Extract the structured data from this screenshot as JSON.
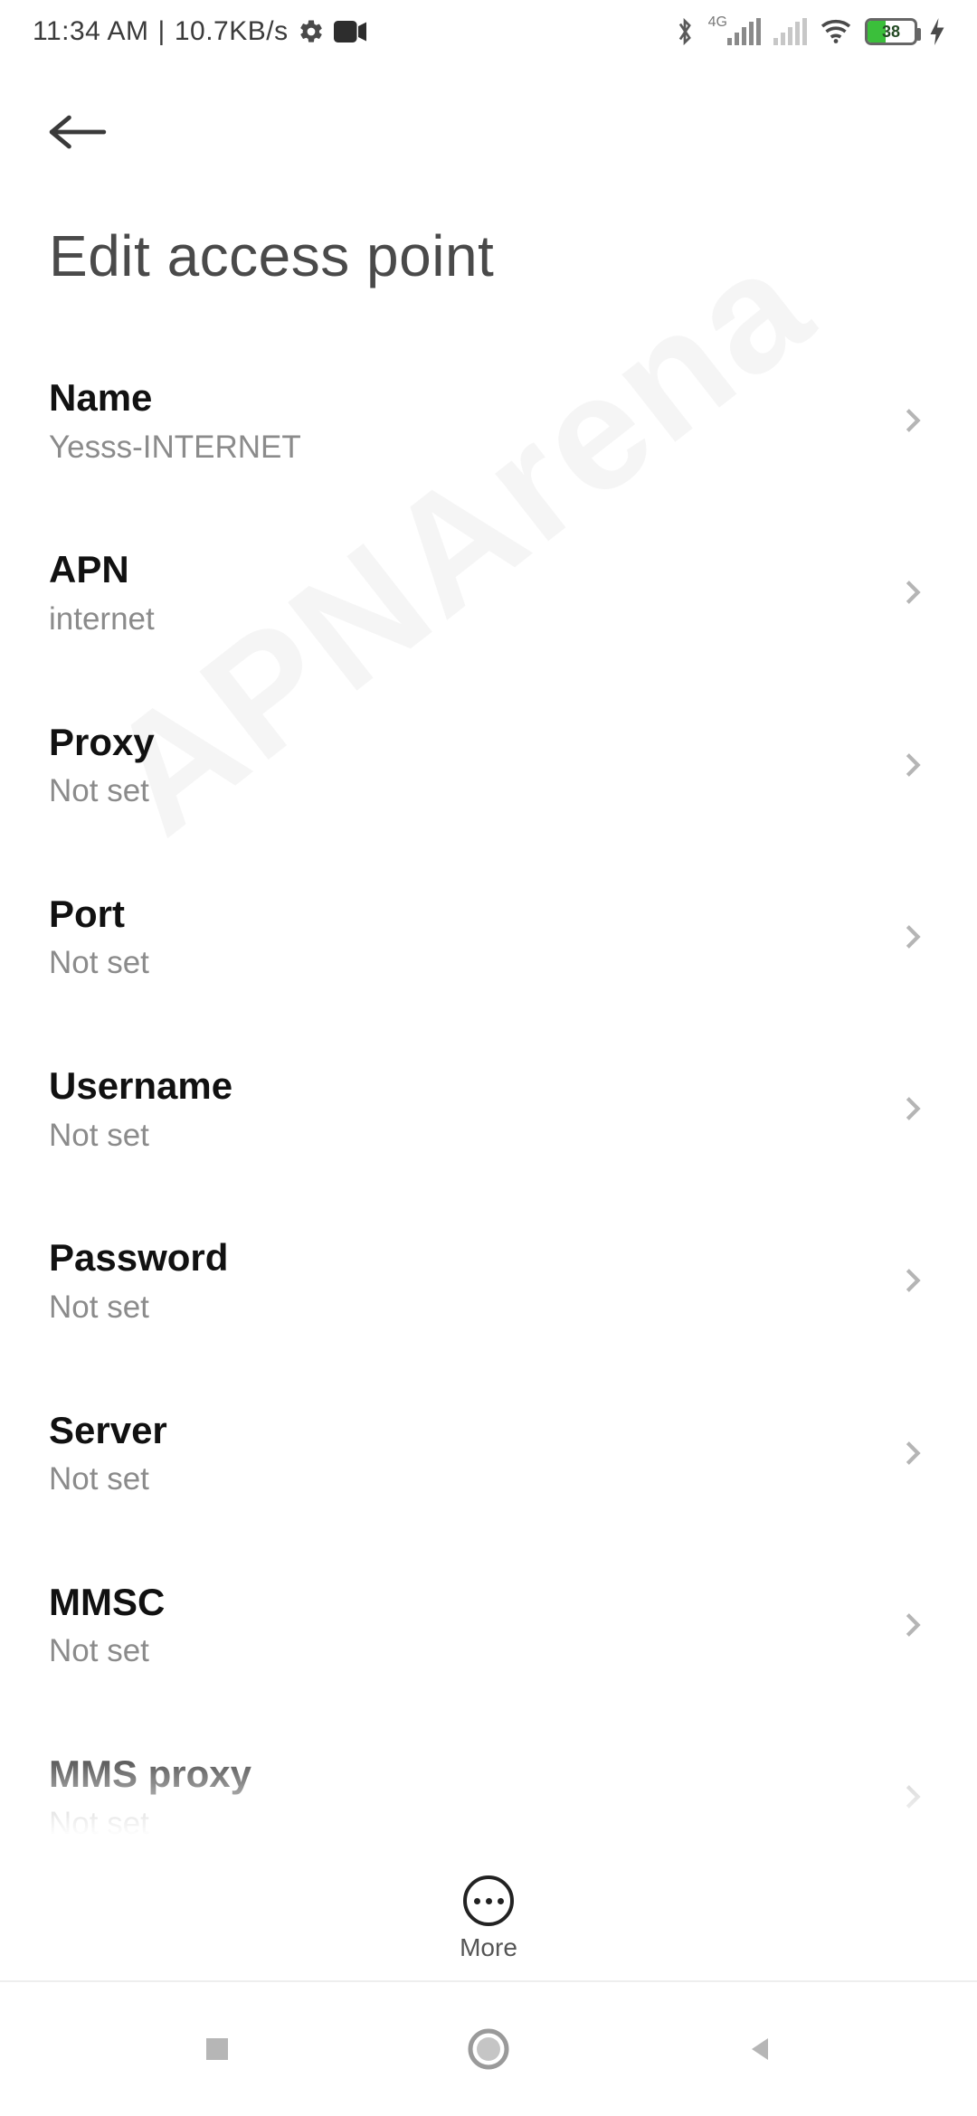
{
  "status": {
    "time": "11:34 AM",
    "net_speed": "10.7KB/s",
    "network_type": "4G",
    "battery_percent": "38"
  },
  "header": {
    "title": "Edit access point"
  },
  "rows": [
    {
      "label": "Name",
      "value": "Yesss-INTERNET"
    },
    {
      "label": "APN",
      "value": "internet"
    },
    {
      "label": "Proxy",
      "value": "Not set"
    },
    {
      "label": "Port",
      "value": "Not set"
    },
    {
      "label": "Username",
      "value": "Not set"
    },
    {
      "label": "Password",
      "value": "Not set"
    },
    {
      "label": "Server",
      "value": "Not set"
    },
    {
      "label": "MMSC",
      "value": "Not set"
    },
    {
      "label": "MMS proxy",
      "value": "Not set"
    }
  ],
  "more": {
    "label": "More"
  },
  "watermark": "APNArena"
}
